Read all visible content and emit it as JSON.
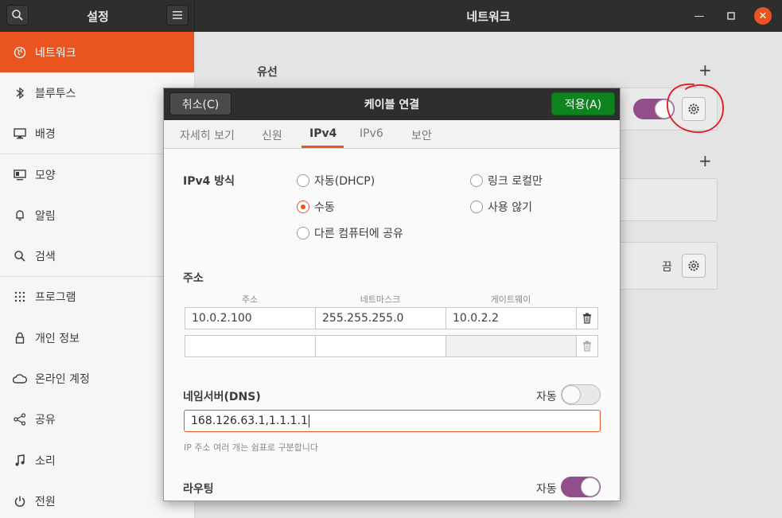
{
  "window": {
    "sidebar_title": "설정",
    "main_title": "네트워크",
    "controls": [
      "minimize-icon",
      "maximize-icon",
      "close-icon"
    ]
  },
  "sidebar": {
    "items": [
      {
        "label": "네트워크",
        "icon": "network-icon",
        "active": true
      },
      {
        "label": "블루투스",
        "icon": "bluetooth-icon"
      },
      {
        "label": "배경",
        "icon": "background-icon"
      },
      {
        "label": "모양",
        "icon": "appearance-icon"
      },
      {
        "label": "알림",
        "icon": "bell-icon"
      },
      {
        "label": "검색",
        "icon": "search-icon"
      },
      {
        "label": "프로그램",
        "icon": "apps-grid-icon"
      },
      {
        "label": "개인 정보",
        "icon": "lock-icon"
      },
      {
        "label": "온라인 계정",
        "icon": "cloud-icon"
      },
      {
        "label": "공유",
        "icon": "share-icon"
      },
      {
        "label": "소리",
        "icon": "music-note-icon"
      },
      {
        "label": "전원",
        "icon": "power-icon"
      }
    ]
  },
  "main": {
    "wired_title": "유선",
    "vpn_off_label": "끔"
  },
  "dialog": {
    "cancel_label": "취소(C)",
    "title": "케이블 연결",
    "apply_label": "적용(A)",
    "tabs": [
      "자세히 보기",
      "신원",
      "IPv4",
      "IPv6",
      "보안"
    ],
    "active_tab": "IPv4",
    "ipv4_method_label": "IPv4 방식",
    "methods": [
      {
        "label": "자동(DHCP)",
        "selected": false
      },
      {
        "label": "링크 로컬만",
        "selected": false
      },
      {
        "label": "수동",
        "selected": true
      },
      {
        "label": "사용 않기",
        "selected": false
      },
      {
        "label": "다른 컴퓨터에 공유",
        "selected": false
      }
    ],
    "address_section": "주소",
    "columns": [
      "주소",
      "네트마스크",
      "게이트웨이"
    ],
    "rows": [
      {
        "address": "10.0.2.100",
        "netmask": "255.255.255.0",
        "gateway": "10.0.2.2"
      },
      {
        "address": "",
        "netmask": "",
        "gateway": ""
      }
    ],
    "dns_label": "네임서버(DNS)",
    "dns_auto_label": "자동",
    "dns_auto_on": false,
    "dns_value": "168.126.63.1,1.1.1.1",
    "dns_hint": "IP 주소 여러 개는 쉼표로 구분합니다",
    "routing_label": "라우팅",
    "routing_auto_label": "자동",
    "routing_auto_on": true
  },
  "colors": {
    "accent": "#e95420",
    "apply_green": "#0e8420",
    "toggle_on": "#924d8b",
    "annotation_red": "#e8141e"
  }
}
